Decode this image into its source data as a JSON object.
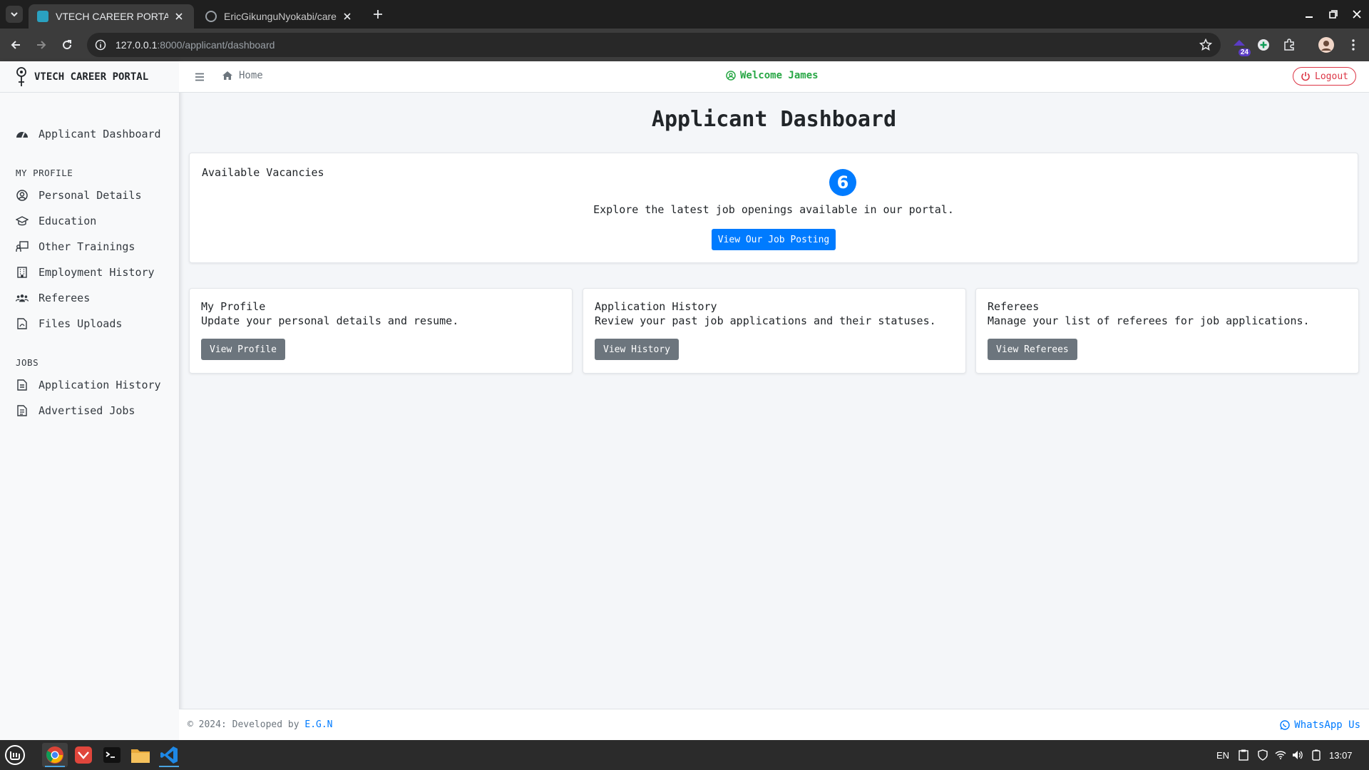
{
  "browser": {
    "tabs": [
      {
        "title": "VTECH CAREER PORTAL",
        "active": true
      },
      {
        "title": "EricGikunguNyokabi/career-",
        "active": false
      }
    ],
    "url_host": "127.0.0.1",
    "url_rest": ":8000/applicant/dashboard",
    "extension_badge": "24"
  },
  "sidebar": {
    "brand": "VTECH CAREER PORTAL",
    "dashboard": {
      "label": "Applicant Dashboard",
      "icon": "dashboard-gauge-icon"
    },
    "profile_header": "MY PROFILE",
    "profile_items": [
      {
        "label": "Personal Details",
        "icon": "user-circle-icon"
      },
      {
        "label": "Education",
        "icon": "graduation-cap-icon"
      },
      {
        "label": "Other Trainings",
        "icon": "chalkboard-teacher-icon"
      },
      {
        "label": "Employment History",
        "icon": "building-icon"
      },
      {
        "label": "Referees",
        "icon": "users-icon"
      },
      {
        "label": "Files Uploads",
        "icon": "file-pdf-icon"
      }
    ],
    "jobs_header": "JOBS",
    "job_items": [
      {
        "label": "Application History",
        "icon": "file-invoice-icon"
      },
      {
        "label": "Advertised Jobs",
        "icon": "file-alt-icon"
      }
    ]
  },
  "topnav": {
    "home": "Home",
    "welcome": "Welcome James",
    "logout": "Logout"
  },
  "main": {
    "title": "Applicant Dashboard",
    "vacancies": {
      "label": "Available Vacancies",
      "count": "6",
      "text": "Explore the latest job openings available in our portal.",
      "button": "View Our Job Posting"
    },
    "cards": [
      {
        "title": "My Profile",
        "desc": "Update your personal details and resume.",
        "button": "View Profile"
      },
      {
        "title": "Application History",
        "desc": "Review your past job applications and their statuses.",
        "button": "View History"
      },
      {
        "title": "Referees",
        "desc": "Manage your list of referees for job applications.",
        "button": "View Referees"
      }
    ]
  },
  "footer": {
    "prefix": "© 2024: Developed by",
    "author": "E.G.N",
    "whatsapp": "WhatsApp Us"
  },
  "taskbar": {
    "lang": "EN",
    "time": "13:07"
  },
  "colors": {
    "primary": "#007bff",
    "secondary": "#6c757d",
    "success": "#28a745",
    "danger": "#dc3545"
  }
}
